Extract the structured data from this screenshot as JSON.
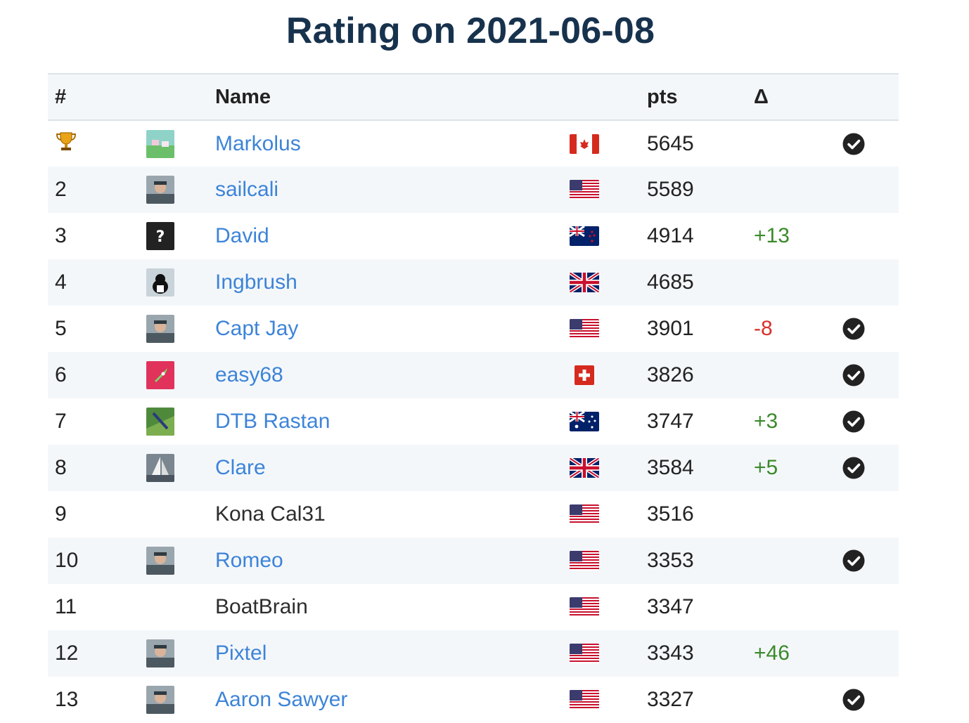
{
  "title": "Rating on 2021-06-08",
  "columns": {
    "rank": "#",
    "name": "Name",
    "pts": "pts",
    "delta": "Δ"
  },
  "colors": {
    "link": "#3d84d8",
    "positive": "#3a8a2a",
    "negative": "#d9312b",
    "title": "#17324d"
  },
  "rows": [
    {
      "rank": "",
      "rank_icon": "trophy-icon",
      "avatar": "landscape",
      "name": "Markolus",
      "linked": true,
      "flag": "ca",
      "pts": "5645",
      "delta": "",
      "verified": true
    },
    {
      "rank": "2",
      "avatar": "person",
      "name": "sailcali",
      "linked": true,
      "flag": "us",
      "pts": "5589",
      "delta": "",
      "verified": false
    },
    {
      "rank": "3",
      "avatar": "question",
      "name": "David",
      "linked": true,
      "flag": "nz",
      "pts": "4914",
      "delta": "+13",
      "verified": false
    },
    {
      "rank": "4",
      "avatar": "cat",
      "name": "Ingbrush",
      "linked": true,
      "flag": "gb",
      "pts": "4685",
      "delta": "",
      "verified": false
    },
    {
      "rank": "5",
      "avatar": "person",
      "name": "Capt Jay",
      "linked": true,
      "flag": "us",
      "pts": "3901",
      "delta": "-8",
      "verified": true
    },
    {
      "rank": "6",
      "avatar": "rocket",
      "name": "easy68",
      "linked": true,
      "flag": "ch",
      "pts": "3826",
      "delta": "",
      "verified": true
    },
    {
      "rank": "7",
      "avatar": "green",
      "name": "DTB Rastan",
      "linked": true,
      "flag": "au",
      "pts": "3747",
      "delta": "+3",
      "verified": true
    },
    {
      "rank": "8",
      "avatar": "sail",
      "name": "Clare",
      "linked": true,
      "flag": "gb",
      "pts": "3584",
      "delta": "+5",
      "verified": true
    },
    {
      "rank": "9",
      "avatar": "",
      "name": "Kona Cal31",
      "linked": false,
      "flag": "us",
      "pts": "3516",
      "delta": "",
      "verified": false
    },
    {
      "rank": "10",
      "avatar": "person",
      "name": "Romeo",
      "linked": true,
      "flag": "us",
      "pts": "3353",
      "delta": "",
      "verified": true
    },
    {
      "rank": "11",
      "avatar": "",
      "name": "BoatBrain",
      "linked": false,
      "flag": "us",
      "pts": "3347",
      "delta": "",
      "verified": false
    },
    {
      "rank": "12",
      "avatar": "person",
      "name": "Pixtel",
      "linked": true,
      "flag": "us",
      "pts": "3343",
      "delta": "+46",
      "verified": false
    },
    {
      "rank": "13",
      "avatar": "person",
      "name": "Aaron Sawyer",
      "linked": true,
      "flag": "us",
      "pts": "3327",
      "delta": "",
      "verified": true
    }
  ]
}
